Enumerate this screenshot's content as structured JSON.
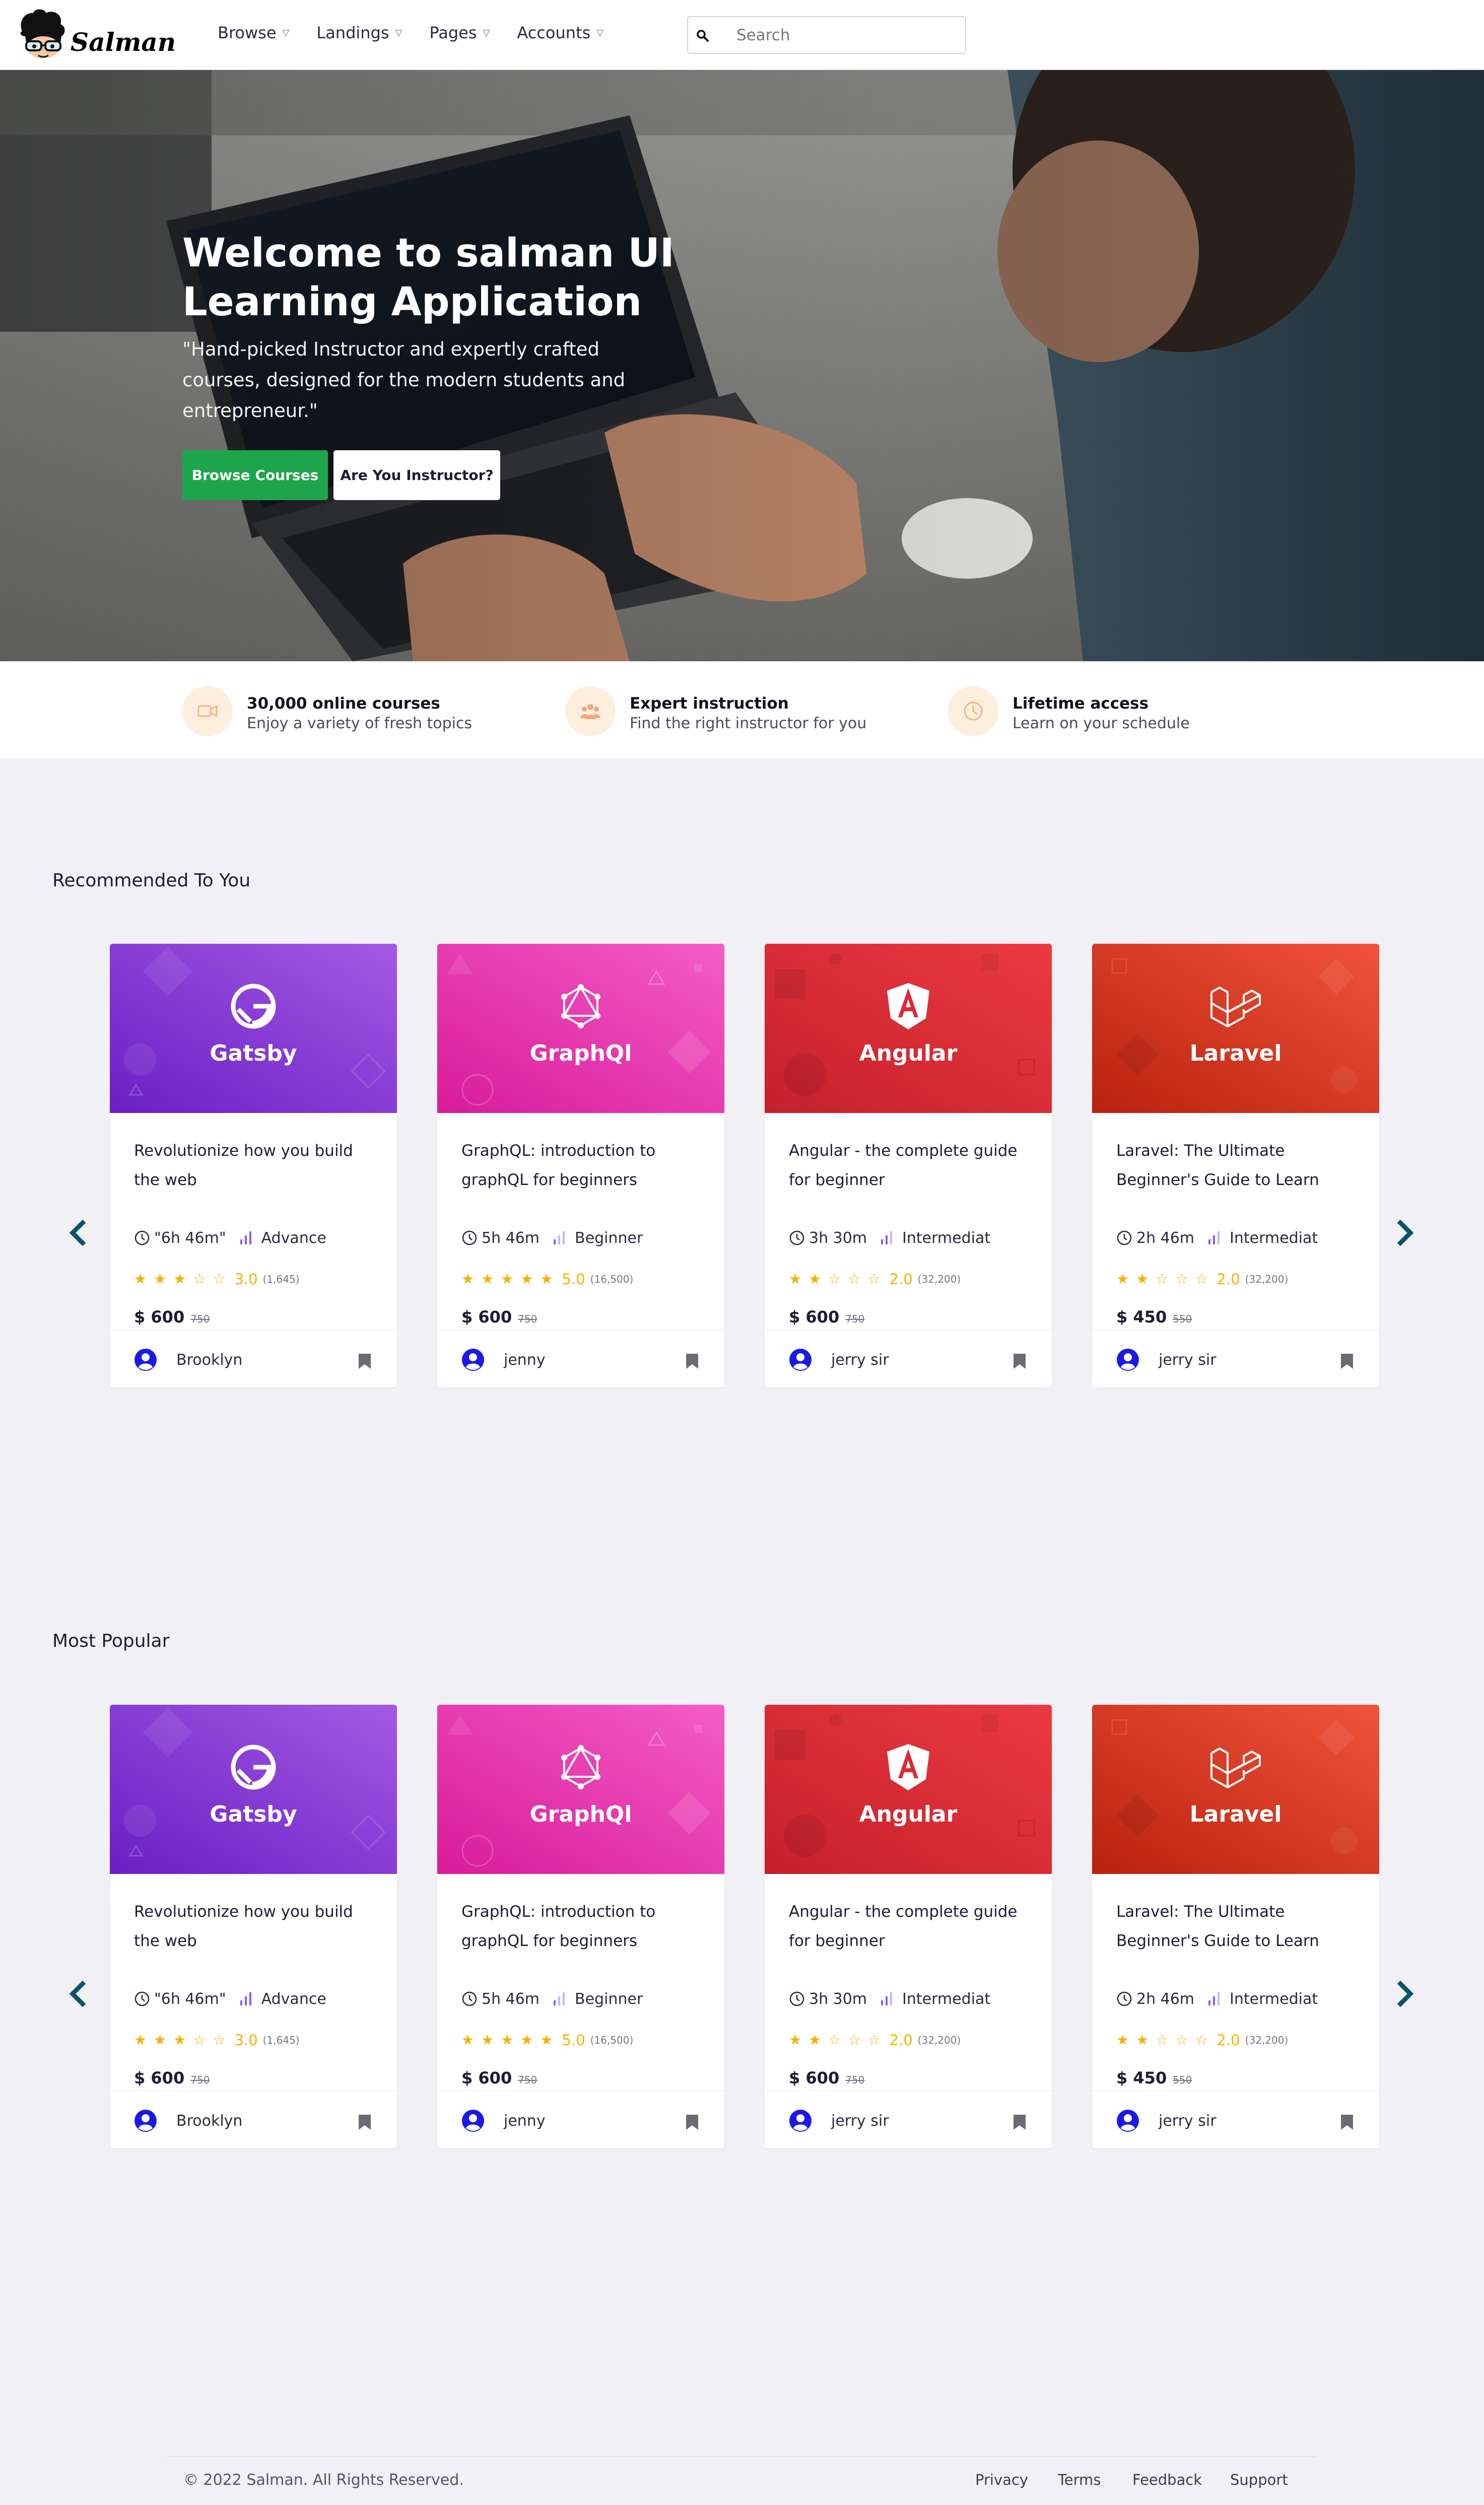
{
  "brand": {
    "name": "Salman"
  },
  "nav": {
    "items": [
      {
        "label": "Browse"
      },
      {
        "label": "Landings"
      },
      {
        "label": "Pages"
      },
      {
        "label": "Accounts"
      }
    ],
    "search_placeholder": "Search"
  },
  "hero": {
    "title": "Welcome to salman UI Learning Application",
    "text": "\"Hand-picked Instructor and expertly crafted courses, designed for the modern students and entrepreneur.\"",
    "primary_button": "Browse Courses",
    "secondary_button": "Are You Instructor?"
  },
  "features": [
    {
      "icon": "video-icon",
      "title": "30,000 online courses",
      "subtitle": "Enjoy a variety of fresh topics"
    },
    {
      "icon": "users-icon",
      "title": "Expert instruction",
      "subtitle": "Find the right instructor for you"
    },
    {
      "icon": "clock-icon",
      "title": "Lifetime access",
      "subtitle": "Learn on your schedule"
    }
  ],
  "sections": [
    {
      "title": "Recommended To You",
      "courses": [
        {
          "banner": "Gatsby",
          "title": "Revolutionize how you build the web",
          "duration": "\"6h 46m\"",
          "level": "Advance",
          "rating": "3.0",
          "stars": 3,
          "reviews": "(1,645)",
          "price": "$ 600",
          "old_price": "750",
          "author": "Brooklyn"
        },
        {
          "banner": "GraphQl",
          "title": "GraphQL: introduction to graphQL for beginners",
          "duration": "5h 46m",
          "level": "Beginner",
          "rating": "5.0",
          "stars": 5,
          "reviews": "(16,500)",
          "price": "$ 600",
          "old_price": "750",
          "author": "jenny"
        },
        {
          "banner": "Angular",
          "title": "Angular - the complete guide for beginner",
          "duration": "3h 30m",
          "level": "Intermediat",
          "rating": "2.0",
          "stars": 2,
          "reviews": "(32,200)",
          "price": "$ 600",
          "old_price": "750",
          "author": "jerry sir"
        },
        {
          "banner": "Laravel",
          "title": "Laravel: The Ultimate Beginner's Guide to Learn",
          "duration": "2h 46m",
          "level": "Intermediat",
          "rating": "2.0",
          "stars": 2,
          "reviews": "(32,200)",
          "price": "$ 450",
          "old_price": "550",
          "author": "jerry sir"
        }
      ]
    },
    {
      "title": "Most Popular",
      "courses": [
        {
          "banner": "Gatsby",
          "title": "Revolutionize how you build the web",
          "duration": "\"6h 46m\"",
          "level": "Advance",
          "rating": "3.0",
          "stars": 3,
          "reviews": "(1,645)",
          "price": "$ 600",
          "old_price": "750",
          "author": "Brooklyn"
        },
        {
          "banner": "GraphQl",
          "title": "GraphQL: introduction to graphQL for beginners",
          "duration": "5h 46m",
          "level": "Beginner",
          "rating": "5.0",
          "stars": 5,
          "reviews": "(16,500)",
          "price": "$ 600",
          "old_price": "750",
          "author": "jenny"
        },
        {
          "banner": "Angular",
          "title": "Angular - the complete guide for beginner",
          "duration": "3h 30m",
          "level": "Intermediat",
          "rating": "2.0",
          "stars": 2,
          "reviews": "(32,200)",
          "price": "$ 600",
          "old_price": "750",
          "author": "jerry sir"
        },
        {
          "banner": "Laravel",
          "title": "Laravel: The Ultimate Beginner's Guide to Learn",
          "duration": "2h 46m",
          "level": "Intermediat",
          "rating": "2.0",
          "stars": 2,
          "reviews": "(32,200)",
          "price": "$ 450",
          "old_price": "550",
          "author": "jerry sir"
        }
      ]
    }
  ],
  "footer": {
    "copyright": "© 2022 Salman. All Rights Reserved.",
    "links": [
      "Privacy",
      "Terms",
      "Feedback",
      "Support"
    ]
  },
  "colors": {
    "primary": "#1ea54c",
    "star": "#f6b100",
    "arrow": "#0b5568",
    "avatar": "#1a1ae6",
    "gatsby": "#7b2fd0",
    "graphql": "#e535ab",
    "angular": "#dd2a36",
    "laravel": "#e0321f"
  }
}
